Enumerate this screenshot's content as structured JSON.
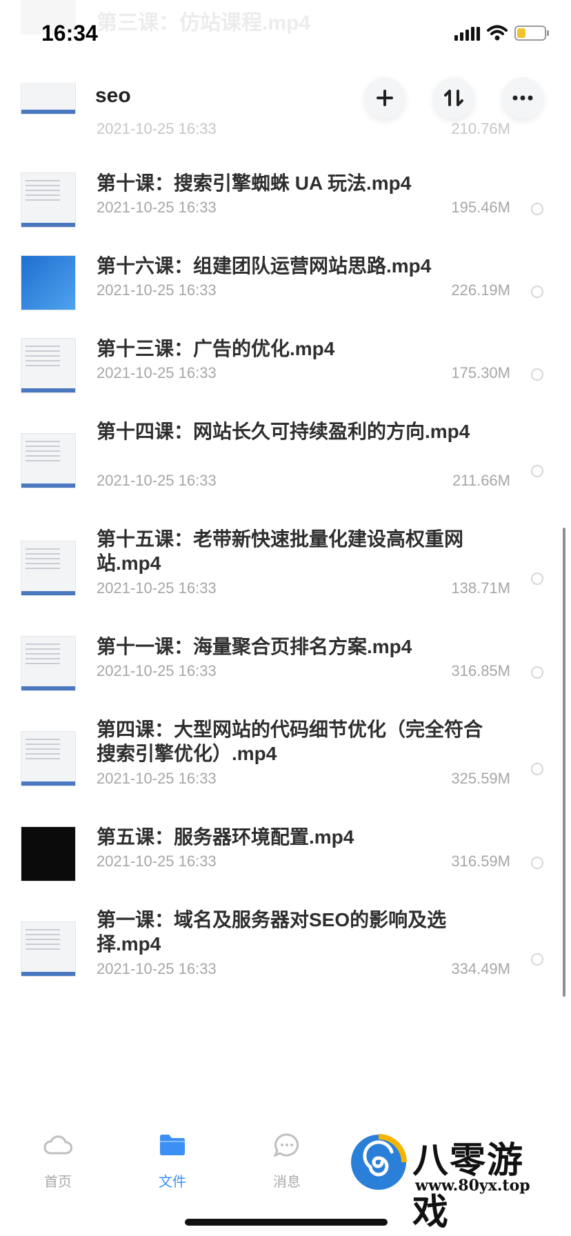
{
  "status_bar": {
    "time": "16:34"
  },
  "ghost_item": {
    "name": "第三课：仿站课程.mp4"
  },
  "nav": {
    "back_icon": "chevron-left-icon",
    "title": "seo",
    "actions": [
      "plus-icon",
      "sort-icon",
      "more-icon"
    ]
  },
  "partial_item": {
    "date": "2021-10-25 16:33",
    "size": "210.76M"
  },
  "files": [
    {
      "name": "第十课：搜索引擎蜘蛛 UA 玩法.mp4",
      "date": "2021-10-25 16:33",
      "size": "195.46M"
    },
    {
      "name": "第十六课：组建团队运营网站思路.mp4",
      "date": "2021-10-25 16:33",
      "size": "226.19M"
    },
    {
      "name": "第十三课：广告的优化.mp4",
      "date": "2021-10-25 16:33",
      "size": "175.30M"
    },
    {
      "name": "第十四课：网站长久可持续盈利的方向.mp4",
      "date": "2021-10-25 16:33",
      "size": "211.66M"
    },
    {
      "name": "第十五课：老带新快速批量化建设高权重网站.mp4",
      "date": "2021-10-25 16:33",
      "size": "138.71M"
    },
    {
      "name": "第十一课：海量聚合页排名方案.mp4",
      "date": "2021-10-25 16:33",
      "size": "316.85M"
    },
    {
      "name": "第四课：大型网站的代码细节优化（完全符合搜索引擎优化）.mp4",
      "date": "2021-10-25 16:33",
      "size": "325.59M"
    },
    {
      "name": "第五课：服务器环境配置.mp4",
      "date": "2021-10-25 16:33",
      "size": "316.59M"
    },
    {
      "name": "第一课：域名及服务器对SEO的影响及选择.mp4",
      "date": "2021-10-25 16:33",
      "size": "334.49M"
    }
  ],
  "tabs": [
    {
      "label": "首页",
      "icon": "cloud-icon"
    },
    {
      "label": "文件",
      "icon": "folder-icon",
      "active": true
    },
    {
      "label": "消息",
      "icon": "chat-icon"
    }
  ],
  "watermark": {
    "name": "八零游戏",
    "url": "www.80yx.top"
  },
  "colors": {
    "accent": "#3b8ff5",
    "muted_text": "#a6a6a6",
    "title_text": "#2e2e2e"
  }
}
